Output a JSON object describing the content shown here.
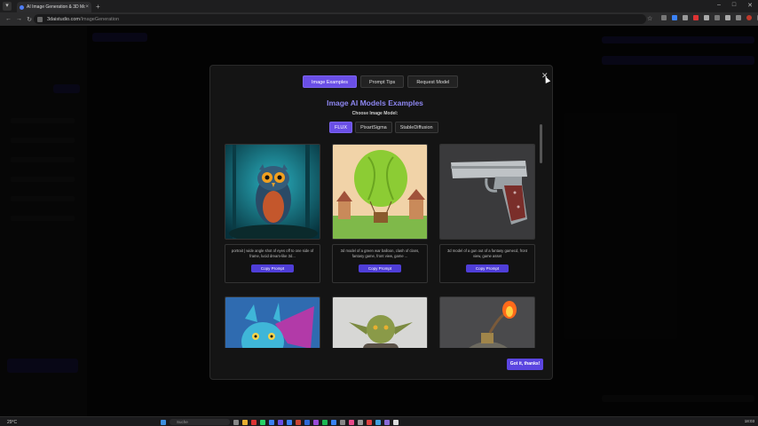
{
  "browser": {
    "tab_title": "AI Image Generation & 3D Mo...",
    "tab_close": "×",
    "new_tab": "+",
    "url_host": "3daistudio.com",
    "url_path": "/ImageGeneration"
  },
  "modal": {
    "tabs": [
      {
        "label": "Image Examples",
        "active": true
      },
      {
        "label": "Prompt Tips",
        "active": false
      },
      {
        "label": "Request Model",
        "active": false
      }
    ],
    "title": "Image AI Models Examples",
    "choose_label": "Choose Image Model:",
    "models": [
      {
        "label": "FLUX",
        "active": true
      },
      {
        "label": "PixartSigma",
        "active": false
      },
      {
        "label": "StableDiffusion",
        "active": false
      }
    ],
    "close_label": "✕",
    "cards": [
      {
        "image": "owl",
        "caption": "portrait | wide angle shot of eyes off to one side of frame, lucid dream-like 3d...",
        "button": "Copy Prompt"
      },
      {
        "image": "balloon",
        "caption": "3d model of a green war balloon, clash of clans, fantasy game, front view, game ...",
        "button": "Copy Prompt"
      },
      {
        "image": "pistol",
        "caption": "3d model of a gun out of a fantasy gamecd, front view, game asset",
        "button": "Copy Prompt"
      },
      {
        "image": "dragon",
        "caption": "",
        "button": ""
      },
      {
        "image": "goblin",
        "caption": "",
        "button": ""
      },
      {
        "image": "bomb",
        "caption": "",
        "button": ""
      }
    ],
    "got_it": "Got it, thanks!"
  },
  "taskbar": {
    "weather": "29°C",
    "search_placeholder": "Suche",
    "time": "18:03"
  },
  "colors": {
    "accent": "#6a4fe6",
    "title": "#8d86f0"
  }
}
